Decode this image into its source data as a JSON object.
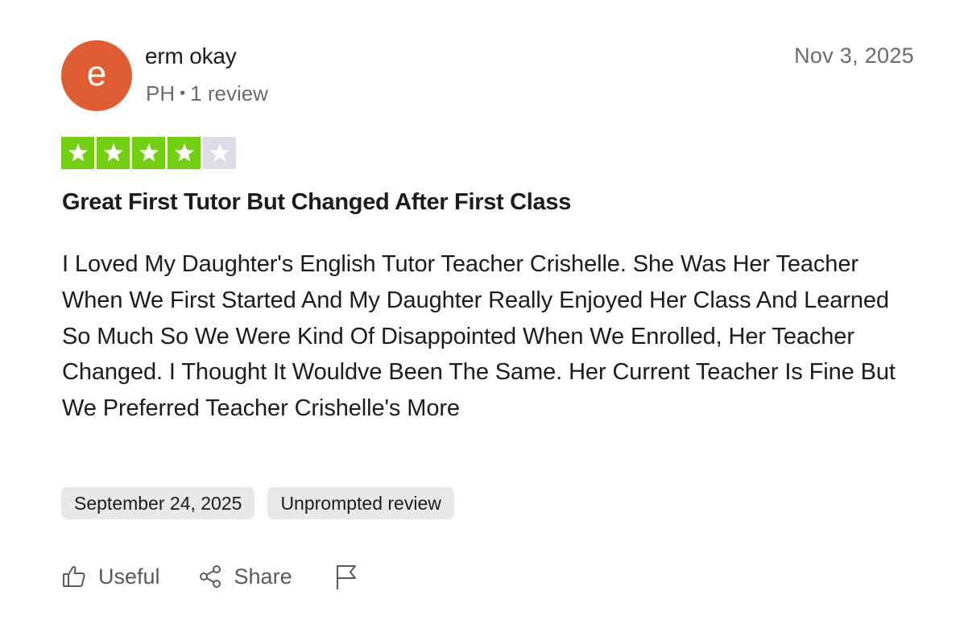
{
  "reviewer": {
    "avatar_letter": "e",
    "name": "erm okay",
    "country": "PH",
    "separator": "•",
    "review_count": "1 review"
  },
  "review": {
    "posted_date": "Nov 3, 2025",
    "rating": 4,
    "rating_max": 5,
    "title": "Great First Tutor But Changed After First Class",
    "body": "I Loved My Daughter's English Tutor Teacher Crishelle. She Was Her Teacher When We First Started And My Daughter Really Enjoyed Her Class And Learned So Much So We Were Kind Of Disappointed When We Enrolled, Her Teacher Changed. I Thought It Wouldve Been The Same. Her Current Teacher Is Fine But We Preferred Teacher Crishelle's More",
    "tags": {
      "experience_date": "September 24, 2025",
      "review_type": "Unprompted review"
    }
  },
  "actions": {
    "useful_label": "Useful",
    "share_label": "Share",
    "useful_icon": "thumbs-up-icon",
    "share_icon": "share-icon",
    "flag_icon": "flag-icon"
  },
  "colors": {
    "avatar_bg": "#e05d33",
    "star_filled_bg": "#73cf11",
    "star_empty_bg": "#dcdce6",
    "text_primary": "#1c1c1c",
    "text_secondary": "#6b6b6b",
    "tag_bg": "#e8e8e8"
  }
}
